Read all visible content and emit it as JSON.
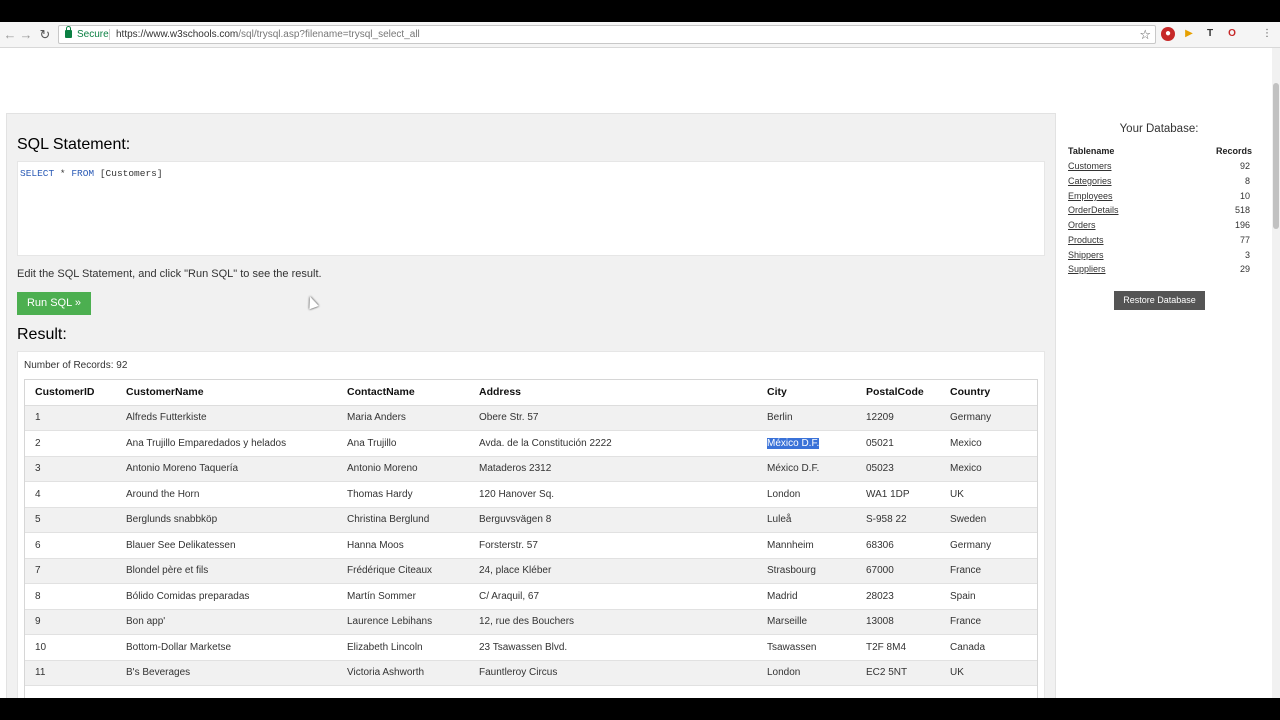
{
  "browser": {
    "secure_label": "Secure",
    "url_prefix": "https://",
    "url_host": "www.w3schools.com",
    "url_path": "/sql/trysql.asp?filename=trysql_select_all"
  },
  "editor": {
    "title": "SQL Statement:",
    "sql_kw1": "SELECT",
    "sql_star": " * ",
    "sql_kw2": "FROM",
    "sql_table": " [Customers]",
    "hint": "Edit the SQL Statement, and click \"Run SQL\" to see the result.",
    "run_label": "Run SQL »"
  },
  "result": {
    "title": "Result:",
    "num_records": "Number of Records: 92",
    "columns": [
      "CustomerID",
      "CustomerName",
      "ContactName",
      "Address",
      "City",
      "PostalCode",
      "Country"
    ],
    "rows": [
      [
        "1",
        "Alfreds Futterkiste",
        "Maria Anders",
        "Obere Str. 57",
        "Berlin",
        "12209",
        "Germany"
      ],
      [
        "2",
        "Ana Trujillo Emparedados y helados",
        "Ana Trujillo",
        "Avda. de la Constitución 2222",
        "México D.F.",
        "05021",
        "Mexico"
      ],
      [
        "3",
        "Antonio Moreno Taquería",
        "Antonio Moreno",
        "Mataderos 2312",
        "México D.F.",
        "05023",
        "Mexico"
      ],
      [
        "4",
        "Around the Horn",
        "Thomas Hardy",
        "120 Hanover Sq.",
        "London",
        "WA1 1DP",
        "UK"
      ],
      [
        "5",
        "Berglunds snabbköp",
        "Christina Berglund",
        "Berguvsvägen 8",
        "Luleå",
        "S-958 22",
        "Sweden"
      ],
      [
        "6",
        "Blauer See Delikatessen",
        "Hanna Moos",
        "Forsterstr. 57",
        "Mannheim",
        "68306",
        "Germany"
      ],
      [
        "7",
        "Blondel père et fils",
        "Frédérique Citeaux",
        "24, place Kléber",
        "Strasbourg",
        "67000",
        "France"
      ],
      [
        "8",
        "Bólido Comidas preparadas",
        "Martín Sommer",
        "C/ Araquil, 67",
        "Madrid",
        "28023",
        "Spain"
      ],
      [
        "9",
        "Bon app'",
        "Laurence Lebihans",
        "12, rue des Bouchers",
        "Marseille",
        "13008",
        "France"
      ],
      [
        "10",
        "Bottom-Dollar Marketse",
        "Elizabeth Lincoln",
        "23 Tsawassen Blvd.",
        "Tsawassen",
        "T2F 8M4",
        "Canada"
      ],
      [
        "11",
        "B's Beverages",
        "Victoria Ashworth",
        "Fauntleroy Circus",
        "London",
        "EC2 5NT",
        "UK"
      ]
    ]
  },
  "database": {
    "title": "Your Database:",
    "col_table": "Tablename",
    "col_records": "Records",
    "tables": [
      {
        "name": "Customers",
        "records": "92"
      },
      {
        "name": "Categories",
        "records": "8"
      },
      {
        "name": "Employees",
        "records": "10"
      },
      {
        "name": "OrderDetails",
        "records": "518"
      },
      {
        "name": "Orders",
        "records": "196"
      },
      {
        "name": "Products",
        "records": "77"
      },
      {
        "name": "Shippers",
        "records": "3"
      },
      {
        "name": "Suppliers",
        "records": "29"
      }
    ],
    "restore_label": "Restore Database"
  },
  "colors": {
    "run_button": "#4caf50",
    "secure": "#0b8043",
    "selection": "#3a72d8"
  }
}
